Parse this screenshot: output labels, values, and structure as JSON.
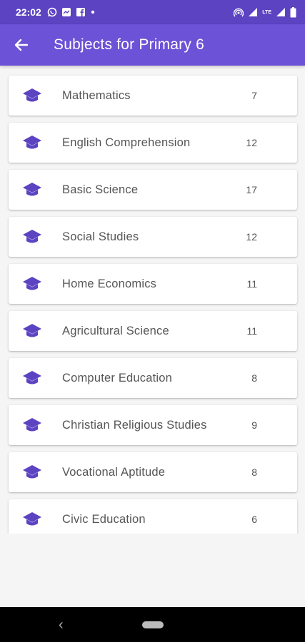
{
  "status_bar": {
    "time": "22:02",
    "lte": "LTE",
    "icons_left": [
      "whatsapp-icon",
      "messenger-icon",
      "facebook-icon",
      "dot-icon"
    ],
    "icons_right": [
      "hotspot-icon",
      "signal-icon",
      "lte-icon",
      "signal-icon",
      "battery-icon"
    ]
  },
  "app_bar": {
    "title": "Subjects for Primary 6",
    "back_icon": "arrow-left-icon",
    "color": "#6b52d6"
  },
  "accent_color": "#5b43c2",
  "subjects": [
    {
      "name": "Mathematics",
      "count": "7"
    },
    {
      "name": "English Comprehension",
      "count": "12"
    },
    {
      "name": "Basic Science",
      "count": "17"
    },
    {
      "name": "Social Studies",
      "count": "12"
    },
    {
      "name": "Home Economics",
      "count": "11"
    },
    {
      "name": "Agricultural Science",
      "count": "11"
    },
    {
      "name": "Computer Education",
      "count": "8"
    },
    {
      "name": "Christian Religious Studies",
      "count": "9"
    },
    {
      "name": "Vocational Aptitude",
      "count": "8"
    },
    {
      "name": "Civic Education",
      "count": "6"
    }
  ],
  "nav_bar": {
    "back_icon": "nav-back-icon",
    "home_icon": "nav-home-pill"
  }
}
